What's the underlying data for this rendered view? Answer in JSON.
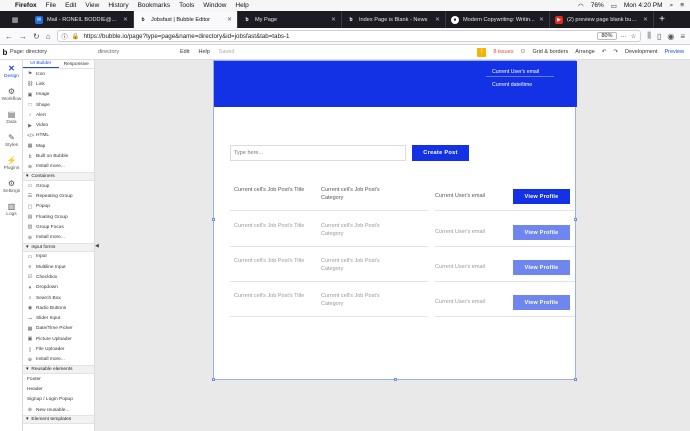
{
  "menubar": {
    "app": "Firefox",
    "items": [
      "File",
      "Edit",
      "View",
      "History",
      "Bookmarks",
      "Tools",
      "Window",
      "Help"
    ],
    "battery": "76%",
    "clock": "Mon 4:20 PM"
  },
  "tabs": [
    {
      "title": "Mail - RONEIL BODDIE@...",
      "color": "#1e6fd9"
    },
    {
      "title": "Jobsfast | Bubble Editor",
      "color": "#222222",
      "active": true
    },
    {
      "title": "My Page",
      "color": "#222222"
    },
    {
      "title": "Index Page is Blank - News",
      "color": "#222222"
    },
    {
      "title": "Modern Copywriting: Writin...",
      "color": "#444444"
    },
    {
      "title": "(2) preview page blank bub...",
      "color": "#e0291f"
    }
  ],
  "nav": {
    "url": "https://bubble.io/page?type=page&name=directory&id=jobsfast&tab=tabs-1",
    "zoom": "80%"
  },
  "editor": {
    "page_label": "Page: directory",
    "page_dropdown": "directory",
    "menu": [
      "Edit",
      "Help"
    ],
    "saved": "Saved",
    "issues": "8 issues",
    "grid": "Grid & borders",
    "arrange": "Arrange",
    "version": "Development",
    "preview": "Preview"
  },
  "rail": [
    {
      "label": "Design",
      "icon": "x-design-icon",
      "glyph": "✕",
      "active": true
    },
    {
      "label": "Workflow",
      "icon": "workflow-icon",
      "glyph": "⚙"
    },
    {
      "label": "Data",
      "icon": "data-icon",
      "glyph": "▤"
    },
    {
      "label": "Styles",
      "icon": "styles-icon",
      "glyph": "✎"
    },
    {
      "label": "Plugins",
      "icon": "plugins-icon",
      "glyph": "⚡"
    },
    {
      "label": "Settings",
      "icon": "settings-icon",
      "glyph": "⚙"
    },
    {
      "label": "Logs",
      "icon": "logs-icon",
      "glyph": "▥"
    }
  ],
  "palette": {
    "tabs": [
      "UI Builder",
      "Responsive"
    ],
    "visual": [
      "Icon",
      "Link",
      "Image",
      "Shape",
      "Alert",
      "Video",
      "HTML",
      "Map",
      "Built on Bubble",
      "Install more..."
    ],
    "containers_title": "Containers",
    "containers": [
      "Group",
      "Repeating Group",
      "Popup",
      "Floating Group",
      "Group Focus",
      "Install more..."
    ],
    "inputs_title": "Input forms",
    "inputs": [
      "Input",
      "Multiline Input",
      "Checkbox",
      "Dropdown",
      "Search Box",
      "Radio Buttons",
      "Slider Input",
      "Date/Time Picker",
      "Picture Uploader",
      "File Uploader",
      "Install more..."
    ],
    "reusable_title": "Reusable elements",
    "reusable": [
      "Footer",
      "Header",
      "Signup / Login Popup",
      "New reusable..."
    ],
    "templates_title": "Element templates"
  },
  "page": {
    "header_email": "Current User's email",
    "header_date": "Current date/time",
    "search_placeholder": "Type here...",
    "create_post": "Create Post",
    "rows": [
      {
        "title": "Current cell's Job Post's Title",
        "category": "Current cell's Job Post's Category",
        "email": "Current User's email",
        "button": "View Profile"
      },
      {
        "title": "Current cell's Job Post's Title",
        "category": "Current cell's Job Post's Category",
        "email": "Current User's email",
        "button": "View Profile"
      },
      {
        "title": "Current cell's Job Post's Title",
        "category": "Current cell's Job Post's Category",
        "email": "Current User's email",
        "button": "View Profile"
      },
      {
        "title": "Current cell's Job Post's Title",
        "category": "Current cell's Job Post's Category",
        "email": "Current User's email",
        "button": "View Profile"
      }
    ]
  }
}
